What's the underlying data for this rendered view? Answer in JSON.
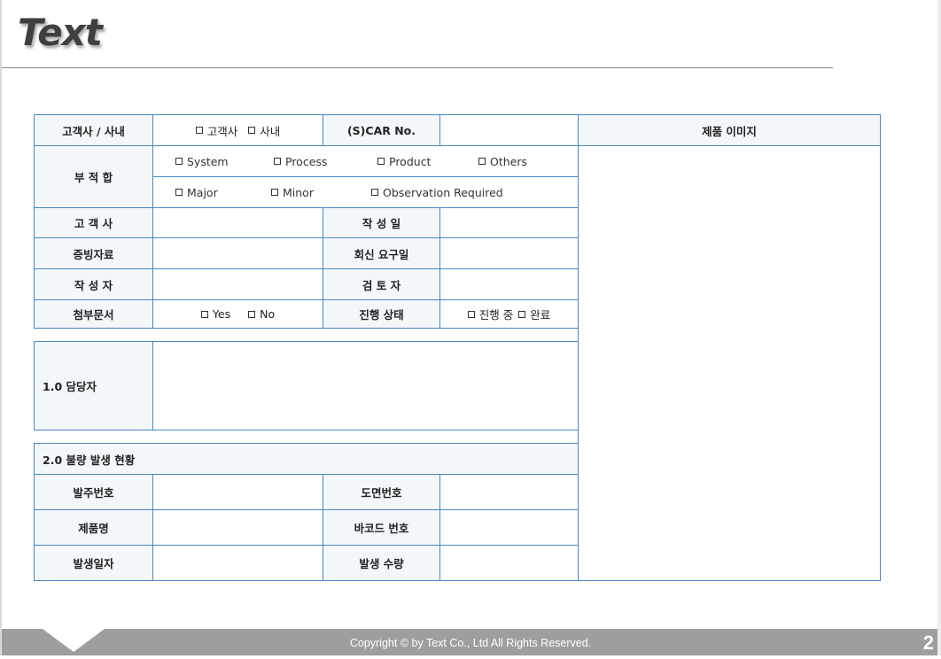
{
  "header": {
    "title": "Text"
  },
  "form": {
    "row1": {
      "label": "고객사 / 사내",
      "options": [
        "고객사",
        "사내"
      ],
      "car_label": "(S)CAR No.",
      "car_value": "",
      "image_label": "제품 이미지"
    },
    "nonconformity": {
      "label": "부 적 합",
      "options_row1": [
        "System",
        "Process",
        "Product",
        "Others"
      ],
      "options_row2": [
        "Major",
        "Minor",
        "Observation Required"
      ]
    },
    "customer": {
      "label": "고 객 사",
      "value": "",
      "date_label": "작 성 일",
      "date_value": ""
    },
    "evidence": {
      "label": "증빙자료",
      "value": "",
      "reply_label": "회신 요구일",
      "reply_value": ""
    },
    "author": {
      "label": "작 성 자",
      "value": "",
      "reviewer_label": "검 토 자",
      "reviewer_value": ""
    },
    "attachment": {
      "label": "첨부문서",
      "options": [
        "Yes",
        "No"
      ],
      "status_label": "진행 상태",
      "status_options": [
        "진행 중",
        "완료"
      ]
    },
    "section1": {
      "label": "1.0 담당자",
      "value": ""
    },
    "section2": {
      "label": "2.0 불량 발생 현황",
      "order_label": "발주번호",
      "order_value": "",
      "drawing_label": "도면번호",
      "drawing_value": "",
      "product_label": "제품명",
      "product_value": "",
      "barcode_label": "바코드 번호",
      "barcode_value": "",
      "date_label": "발생일자",
      "date_value": "",
      "qty_label": "발생 수량",
      "qty_value": ""
    }
  },
  "footer": {
    "copyright": "Copyright © by Text Co., Ltd All Rights Reserved.",
    "page_number": "2"
  },
  "colors": {
    "border": "#4a86c5",
    "label_bg": "#f3f7fa",
    "footer_bg": "#9e9e9e",
    "title": "#3f3f3f"
  }
}
